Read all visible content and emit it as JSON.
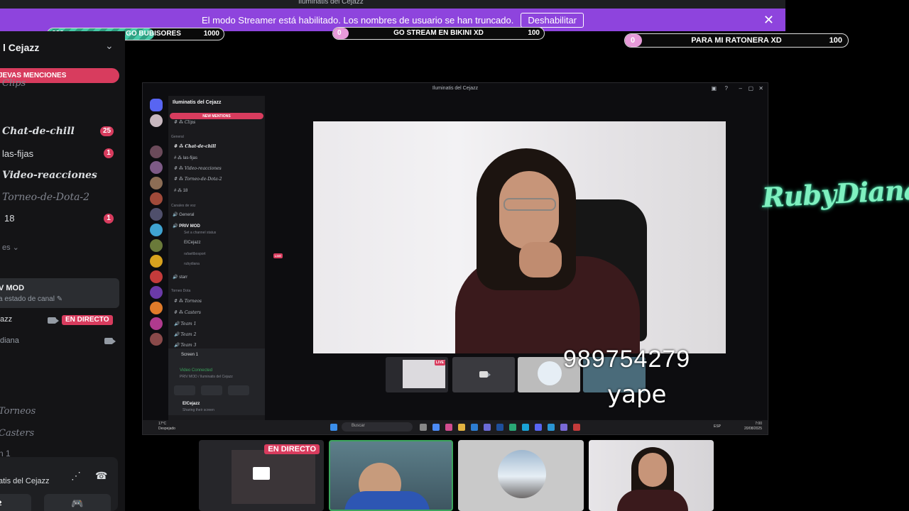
{
  "window": {
    "title": "Iluminatis del Cejazz"
  },
  "streamer_banner": {
    "message": "El modo Streamer está habilitado. Los nombres de usuario se han truncado.",
    "disable_label": "Deshabilitar",
    "close_icon": "close-icon"
  },
  "goals": [
    {
      "start": "606",
      "label": "GO BUBISORES",
      "target": "1000",
      "progress": 0.606
    },
    {
      "start": "0",
      "label": "GO STREAM EN BIKINI XD",
      "target": "100",
      "progress": 0.0
    },
    {
      "start": "0",
      "label": "PARA MI RATONERA XD",
      "target": "100",
      "progress": 0.0
    }
  ],
  "sidebar": {
    "server_name": "l Cejazz",
    "mentions_label": "JEVAS MENCIONES",
    "channels": [
      {
        "name": "Clips",
        "badge": ""
      },
      {
        "name": "Chat-de-chill",
        "badge": "25"
      },
      {
        "name": "las-fijas",
        "badge": "1"
      },
      {
        "name": "Video-reacciones",
        "badge": ""
      },
      {
        "name": "Torneo-de-Dota-2",
        "badge": ""
      },
      {
        "name": "18",
        "badge": "1"
      }
    ],
    "category_voice": "es",
    "voice_channel": {
      "name": "V MOD",
      "status": "a estado de canal"
    },
    "users": [
      {
        "name": "azz",
        "live_label": "EN DIRECTO"
      },
      {
        "name": "diana"
      }
    ],
    "lower_channels": [
      "Torneos",
      "Casters",
      "n 1"
    ],
    "bottom_panel": {
      "name": "atis del Cejazz"
    }
  },
  "captured_window": {
    "title": "Iluminatis del Cejazz",
    "server_name": "Iluminatis del Cejazz",
    "mentions": "NEW MENTIONS",
    "channels": [
      "Clips",
      "General",
      "Chat-de-chill",
      "las-fijas",
      "Video-reacciones",
      "Torneo-de-Dota-2",
      "18",
      "Canales de voz",
      "General",
      "PRIV MOD",
      "Set a channel status",
      "ElCejazz",
      "rafaeltbosport",
      "rubydiana",
      "starr",
      "Torneo Dota",
      "Torneos",
      "Casters",
      "Team 1",
      "Team 2",
      "Team 3"
    ],
    "live_label": "LIVE",
    "screen_label": "Screen 1",
    "video_connected": "Video Connected",
    "video_sub": "PRIV MOD / Iluminatis del Cejazz",
    "user": "ElCejazz",
    "user_status": "Sharing their screen",
    "search_placeholder": "Buscar",
    "weather_temp": "17°C",
    "weather_desc": "Despejado",
    "lang": "ESP",
    "time": "7:00",
    "date": "20/08/2025"
  },
  "overlay": {
    "phone": "989754279",
    "payment": "yape",
    "logo_text": "RubyDiana"
  },
  "bottom_tiles": [
    {
      "name": "tile-stream",
      "live_label": "EN DIRECTO"
    },
    {
      "name": "tile-cam-1"
    },
    {
      "name": "tile-avatar"
    },
    {
      "name": "tile-cam-2"
    }
  ]
}
